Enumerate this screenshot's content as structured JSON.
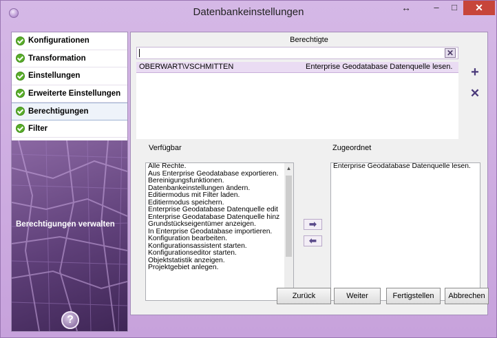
{
  "window": {
    "title": "Datenbankeinstellungen",
    "resize_glyph": "↔",
    "min_glyph": "–",
    "max_glyph": "□",
    "close_glyph": "✕"
  },
  "sidebar": {
    "items": [
      {
        "label": "Konfigurationen",
        "done": true,
        "active": false
      },
      {
        "label": "Transformation",
        "done": true,
        "active": false
      },
      {
        "label": "Einstellungen",
        "done": true,
        "active": false
      },
      {
        "label": "Erweiterte Einstellungen",
        "done": true,
        "active": false
      },
      {
        "label": "Berechtigungen",
        "done": true,
        "active": true
      },
      {
        "label": "Filter",
        "done": true,
        "active": false
      }
    ],
    "caption": "Berechtigungen verwalten",
    "help_glyph": "?"
  },
  "granted": {
    "title": "Berechtigte",
    "search_value": "",
    "clear_glyph": "✕",
    "rows": [
      {
        "user": "OBERWART\\VSCHMITTEN",
        "permission": "Enterprise Geodatabase Datenquelle lesen."
      }
    ],
    "add_glyph": "+",
    "remove_glyph": "✕"
  },
  "available": {
    "label": "Verfügbar",
    "items": [
      "Alle Rechte.",
      "Aus Enterprise Geodatabase exportieren.",
      "Bereinigungsfunktionen.",
      "Datenbankeinstellungen ändern.",
      "Editiermodus mit Filter laden.",
      "Editiermodus speichern.",
      "Enterprise Geodatabase Datenquelle edit",
      "Enterprise Geodatabase Datenquelle hinz",
      "Grundstückseigentümer anzeigen.",
      "In Enterprise Geodatabase importieren.",
      "Konfiguration bearbeiten.",
      "Konfigurationsassistent starten.",
      "Konfigurationseditor starten.",
      "Objektstatistik anzeigen.",
      "Projektgebiet anlegen."
    ]
  },
  "assigned": {
    "label": "Zugeordnet",
    "items": [
      "Enterprise Geodatabase Datenquelle lesen."
    ]
  },
  "move": {
    "right_glyph": "➡",
    "left_glyph": "⬅"
  },
  "buttons": {
    "back": "Zurück",
    "next": "Weiter",
    "finish": "Fertigstellen",
    "cancel": "Abbrechen"
  }
}
